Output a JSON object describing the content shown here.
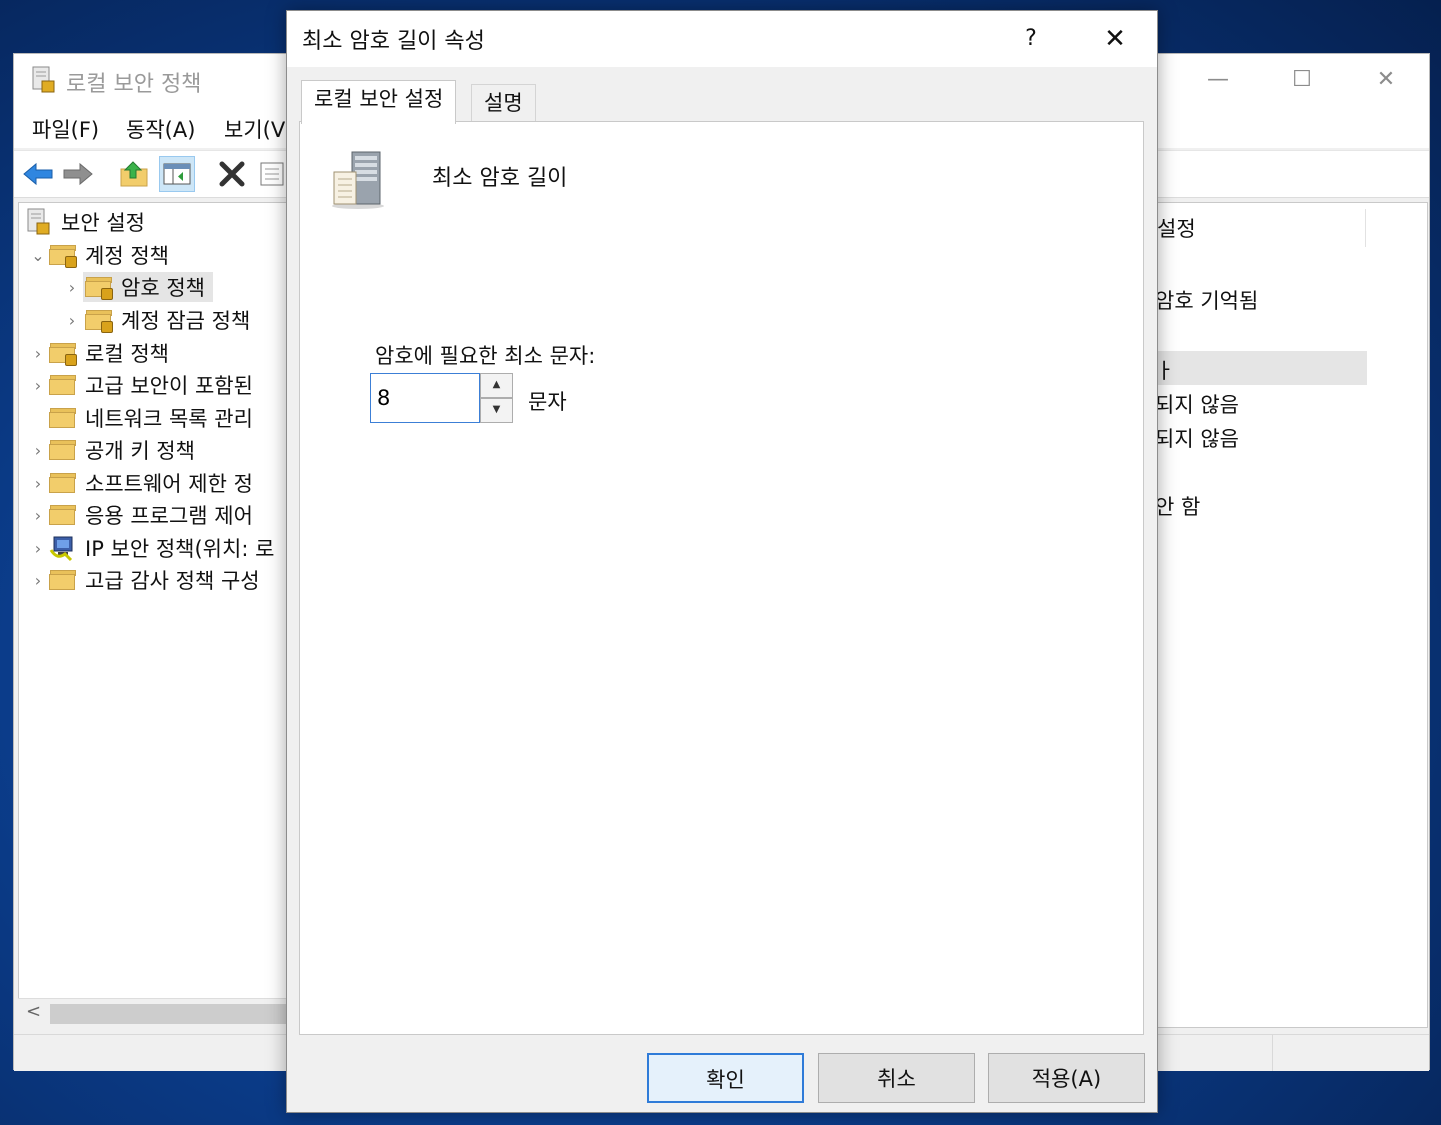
{
  "background_window": {
    "title": "로컬 보안 정책",
    "controls": {
      "minimize": "—",
      "maximize": "☐",
      "close": "✕"
    },
    "menu": [
      {
        "label": "파일(F)"
      },
      {
        "label": "동작(A)"
      },
      {
        "label": "보기(V"
      }
    ],
    "toolbar_icons": [
      "back-arrow-icon",
      "forward-arrow-icon",
      "up-folder-icon",
      "show-hide-tree-icon",
      "delete-icon",
      "properties-icon"
    ],
    "tree": [
      {
        "label": "보안 설정",
        "arrow": ""
      },
      {
        "label": "계정 정책",
        "arrow": "⌄"
      },
      {
        "label": "암호 정책",
        "arrow": "›",
        "selected": true
      },
      {
        "label": "계정 잠금 정책",
        "arrow": "›"
      },
      {
        "label": "로컬 정책",
        "arrow": "›"
      },
      {
        "label": "고급 보안이 포함된",
        "arrow": "›"
      },
      {
        "label": "네트워크 목록 관리",
        "arrow": ""
      },
      {
        "label": "공개 키 정책",
        "arrow": "›"
      },
      {
        "label": "소프트웨어 제한 정",
        "arrow": "›"
      },
      {
        "label": "응용 프로그램 제어",
        "arrow": "›"
      },
      {
        "label": "IP 보안 정책(위치: 로",
        "arrow": "›"
      },
      {
        "label": "고급 감사 정책 구성",
        "arrow": "›"
      }
    ],
    "scroll_left_arrow": "<",
    "right_pane": {
      "header": "설정",
      "values": [
        "암호 기억됨",
        "ㅏ",
        "되지 않음",
        "되지 않음",
        "안 함"
      ]
    }
  },
  "dialog": {
    "title": "최소 암호 길이 속성",
    "help": "?",
    "close": "✕",
    "tabs": [
      {
        "label": "로컬 보안 설정",
        "active": true
      },
      {
        "label": "설명",
        "active": false
      }
    ],
    "policy_name": "최소 암호 길이",
    "field_label": "암호에 필요한 최소 문자:",
    "field_value": "8",
    "spin_up": "▲",
    "spin_down": "▼",
    "unit": "문자",
    "buttons": {
      "ok": "확인",
      "cancel": "취소",
      "apply": "적용(A)"
    }
  },
  "colors": {
    "accent": "#2f7bd8",
    "folder": "#f2cd6b",
    "selection": "#e5e5e5"
  }
}
